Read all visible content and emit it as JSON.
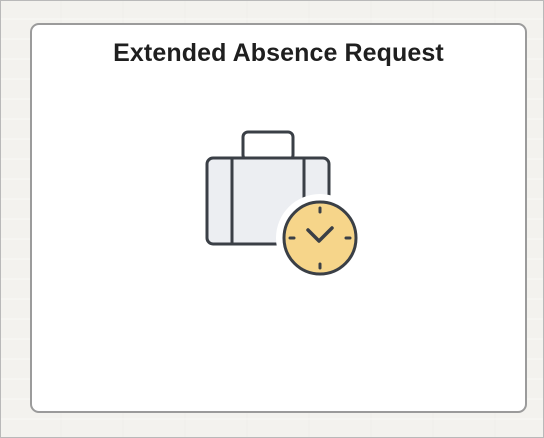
{
  "tile": {
    "title": "Extended Absence Request",
    "icon": "briefcase-clock-icon"
  },
  "colors": {
    "tile_border": "#9b9b9b",
    "icon_outline": "#3a3f46",
    "briefcase_fill": "#eceef2",
    "clock_fill": "#f6d58a"
  }
}
